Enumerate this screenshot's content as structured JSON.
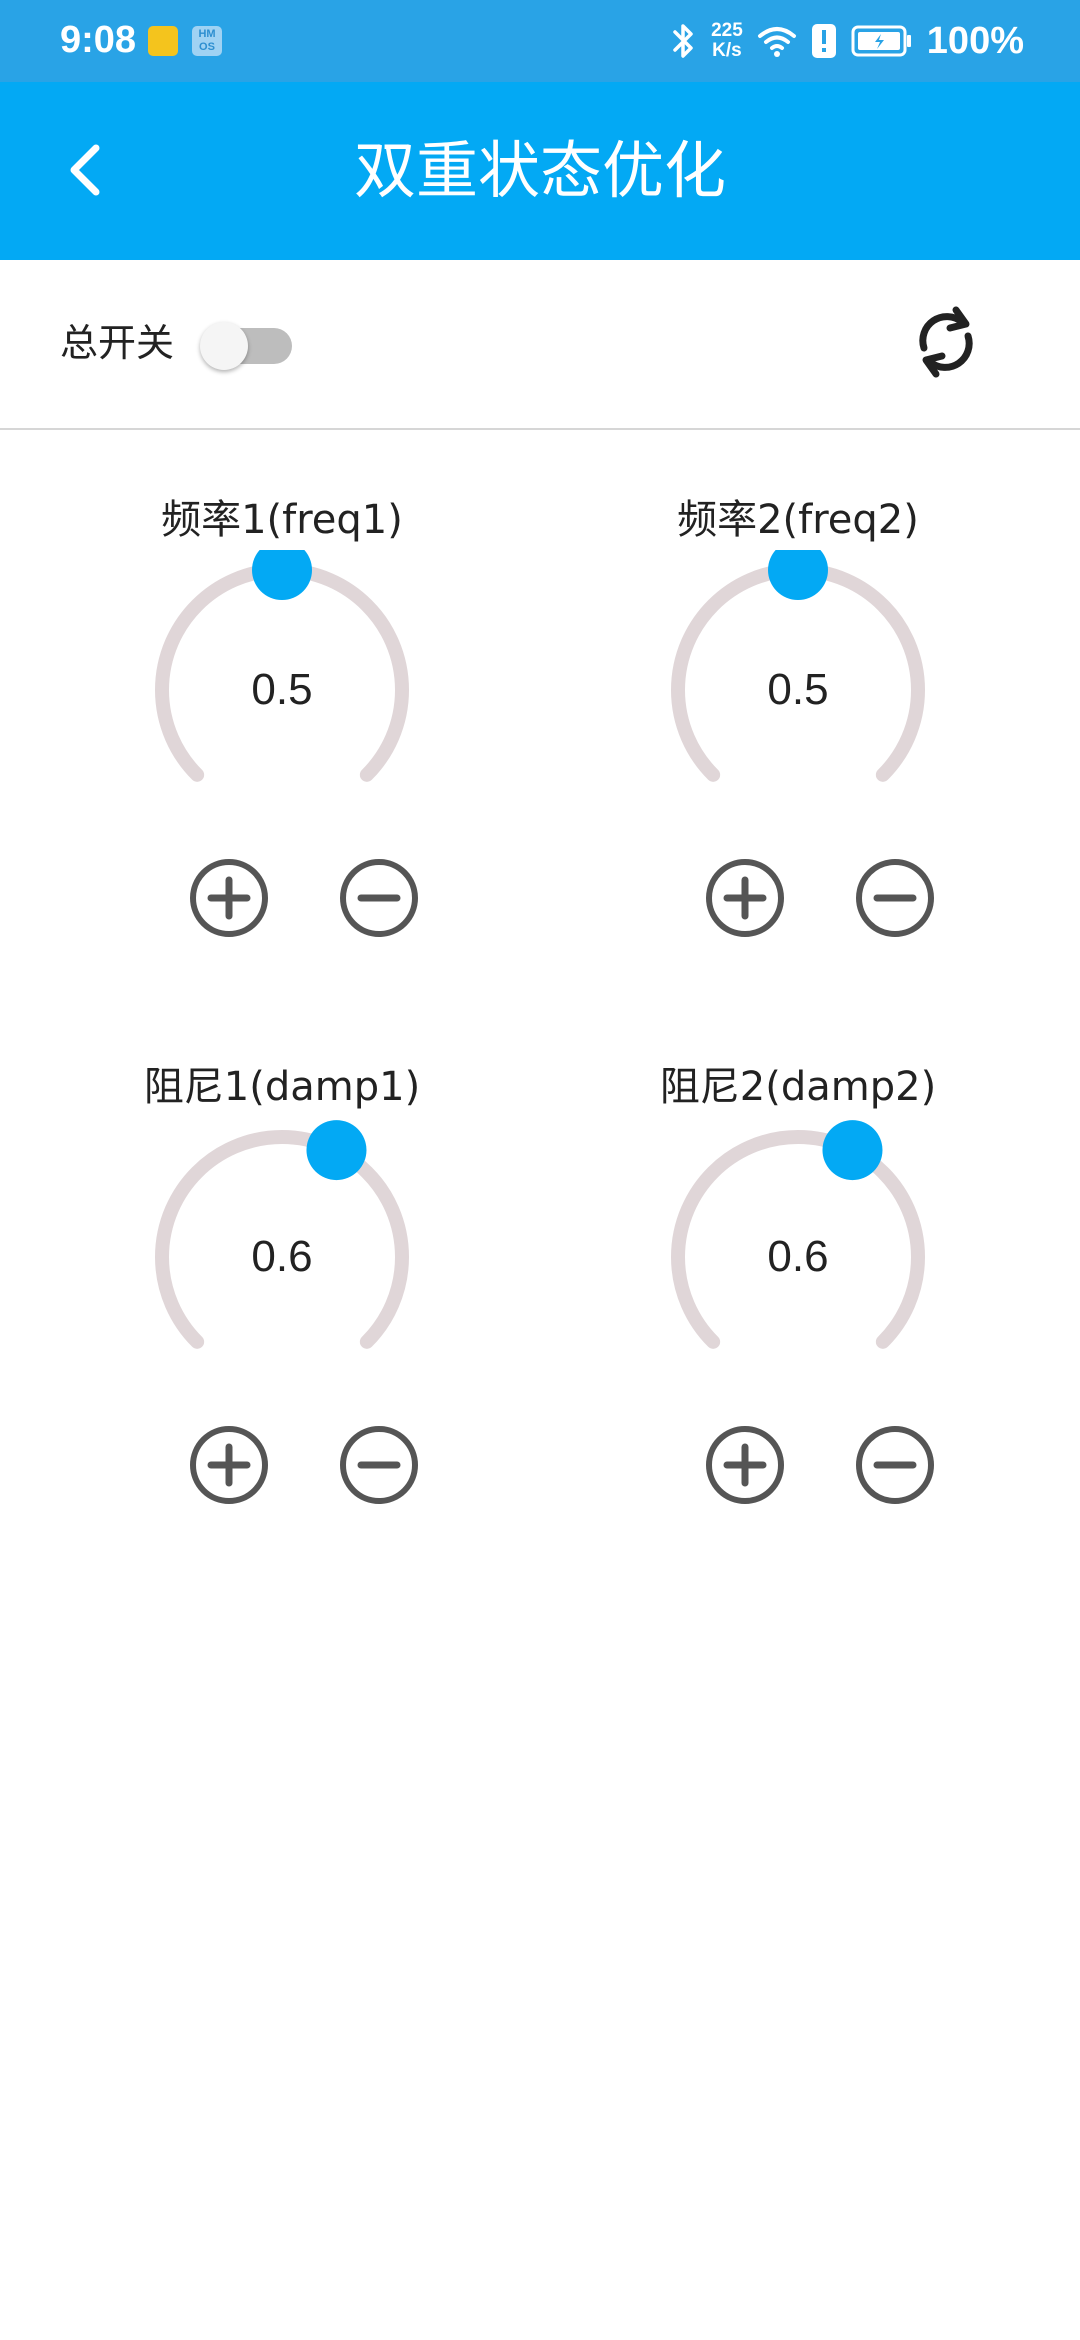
{
  "status_bar": {
    "time": "9:08",
    "hm_badge": "HM OS",
    "net_speed_value": "225",
    "net_speed_unit": "K/s",
    "battery_percent": "100%",
    "background_color": "#29a3e6"
  },
  "app_bar": {
    "title": "双重状态优化",
    "back_icon": "chevron-left-icon",
    "background_color": "#03a9f4"
  },
  "controls": {
    "master_switch_label": "总开关",
    "master_switch_on": false,
    "refresh_icon": "refresh-icon"
  },
  "knobs": [
    {
      "id": "freq1",
      "label": "频率1(freq1)",
      "value": "0.5",
      "fraction": 0.5
    },
    {
      "id": "freq2",
      "label": "频率2(freq2)",
      "value": "0.5",
      "fraction": 0.5
    },
    {
      "id": "damp1",
      "label": "阻尼1(damp1)",
      "value": "0.6",
      "fraction": 0.6
    },
    {
      "id": "damp2",
      "label": "阻尼2(damp2)",
      "value": "0.6",
      "fraction": 0.6
    }
  ],
  "colors": {
    "accent": "#03a9f4",
    "dial_track": "#e0d6d8",
    "button_outline": "#555555"
  }
}
